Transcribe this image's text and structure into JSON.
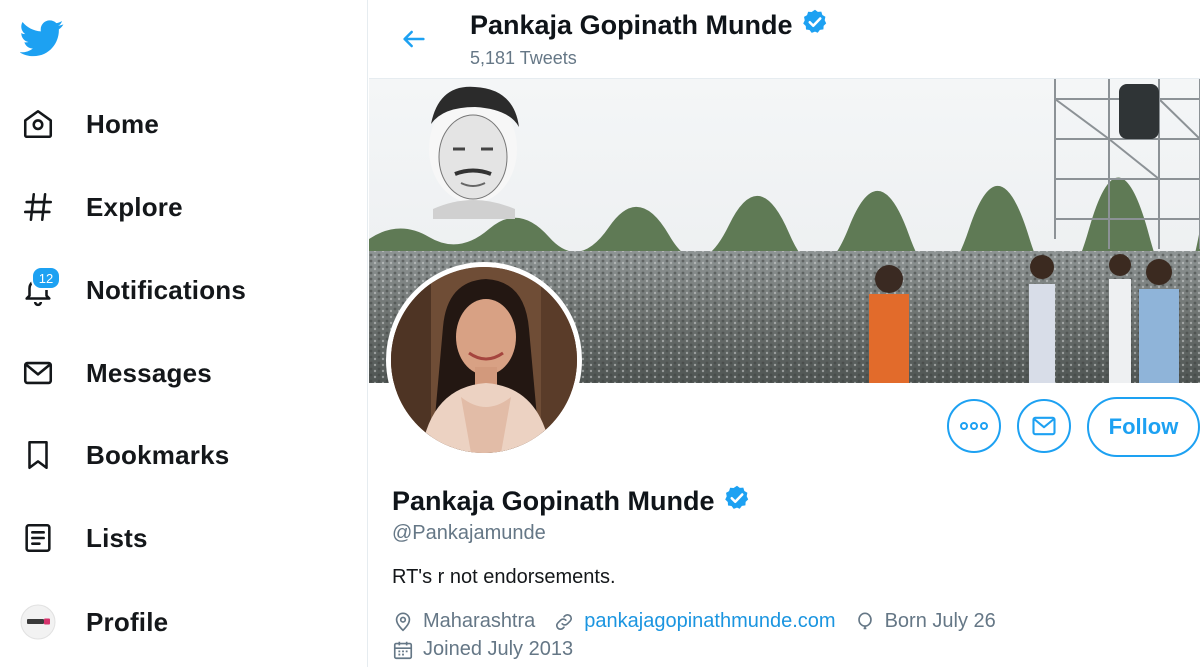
{
  "sidebar": {
    "logo_icon": "twitter-bird-icon",
    "items": [
      {
        "label": "Home",
        "icon": "home-icon"
      },
      {
        "label": "Explore",
        "icon": "hashtag-icon"
      },
      {
        "label": "Notifications",
        "icon": "bell-icon",
        "badge": "12"
      },
      {
        "label": "Messages",
        "icon": "envelope-icon"
      },
      {
        "label": "Bookmarks",
        "icon": "bookmark-icon"
      },
      {
        "label": "Lists",
        "icon": "list-icon"
      },
      {
        "label": "Profile",
        "icon": "avatar-icon"
      }
    ]
  },
  "header": {
    "name": "Pankaja Gopinath Munde",
    "tweet_count": "5,181 Tweets"
  },
  "actions": {
    "follow_label": "Follow"
  },
  "profile": {
    "name": "Pankaja Gopinath Munde",
    "handle": "@Pankajamunde",
    "bio": "RT's r not endorsements.",
    "location": "Maharashtra",
    "website": "pankajagopinathmunde.com",
    "birthday": "Born July 26",
    "joined": "Joined July 2013"
  },
  "colors": {
    "accent": "#1da1f2",
    "link": "#1b95e0",
    "secondary_text": "#657786"
  }
}
